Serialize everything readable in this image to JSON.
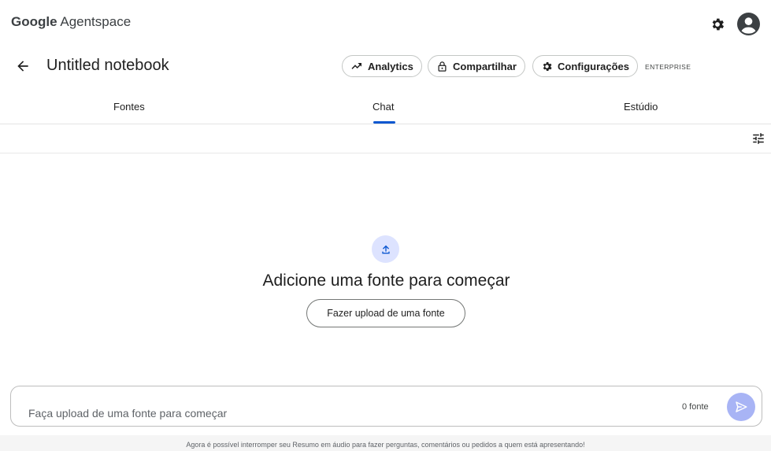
{
  "app": {
    "brand_bold": "Google",
    "brand_rest": "Agentspace"
  },
  "notebook": {
    "title": "Untitled notebook"
  },
  "header_actions": {
    "analytics": "Analytics",
    "share": "Compartilhar",
    "settings": "Configurações",
    "edition_badge": "ENTERPRISE"
  },
  "tabs": [
    {
      "label": "Fontes"
    },
    {
      "label": "Chat",
      "active": true
    },
    {
      "label": "Estúdio"
    }
  ],
  "empty_state": {
    "title": "Adicione uma fonte para começar",
    "upload_button": "Fazer upload de uma fonte"
  },
  "composer": {
    "placeholder": "Faça upload de uma fonte para começar",
    "source_count": "0 fonte"
  },
  "footer": {
    "notice": "Agora é possível interromper seu Resumo em áudio para fazer perguntas, comentários ou pedidos a quem está apresentando!"
  },
  "icons": [
    "settings-icon",
    "account-avatar-icon",
    "back-arrow-icon",
    "trending-up-icon",
    "lock-icon",
    "gear-icon",
    "tune-icon",
    "upload-icon",
    "send-icon"
  ],
  "colors": {
    "accent": "#0b57d0",
    "upload_circle": "#dde3ff",
    "send_button": "#a8b4f5"
  }
}
